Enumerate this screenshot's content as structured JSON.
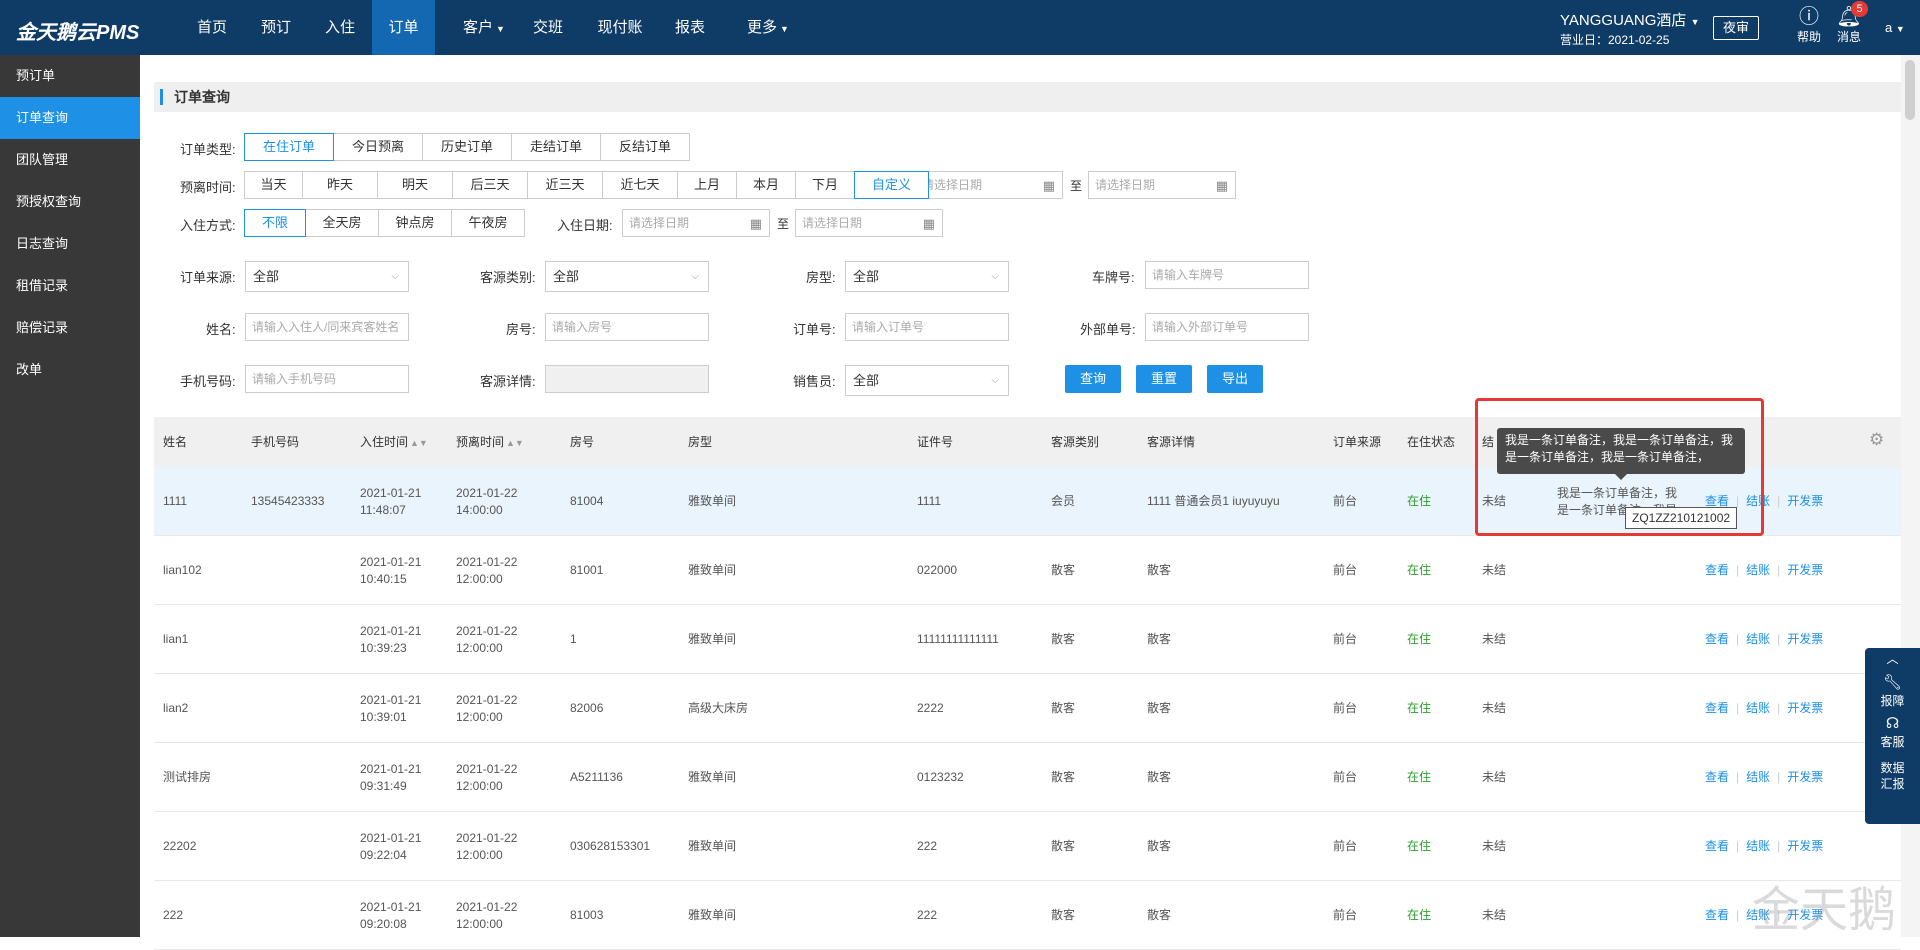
{
  "app": {
    "logo": "金天鹅云PMS"
  },
  "topnav": {
    "items": [
      "首页",
      "预订",
      "入住",
      "订单",
      "客户",
      "交班",
      "现付账",
      "报表",
      "更多"
    ],
    "active": "订单"
  },
  "header": {
    "hotel": "YANGGUANG酒店",
    "business_day": "营业日：2021-02-25",
    "night_audit": "夜审",
    "help": "帮助",
    "messages": "消息",
    "message_count": "5",
    "user": "a"
  },
  "sidebar": {
    "items": [
      "预订单",
      "订单查询",
      "团队管理",
      "预授权查询",
      "日志查询",
      "租借记录",
      "赔偿记录",
      "改单"
    ],
    "active": "订单查询"
  },
  "page": {
    "title": "订单查询"
  },
  "filters": {
    "order_type": {
      "label": "订单类型:",
      "options": [
        "在住订单",
        "今日预离",
        "历史订单",
        "走结订单",
        "反结订单"
      ],
      "selected": "在住订单"
    },
    "departure_time": {
      "label": "预离时间:",
      "options": [
        "当天",
        "昨天",
        "明天",
        "后三天",
        "近三天",
        "近七天",
        "上月",
        "本月",
        "下月",
        "自定义"
      ],
      "selected": "自定义",
      "date_placeholder": "请选择日期",
      "to": "至"
    },
    "checkin_mode": {
      "label": "入住方式:",
      "options": [
        "不限",
        "全天房",
        "钟点房",
        "午夜房"
      ],
      "selected": "不限"
    },
    "checkin_date": {
      "label": "入住日期:",
      "date_placeholder": "请选择日期",
      "to": "至"
    },
    "order_source": {
      "label": "订单来源:",
      "value": "全部"
    },
    "guest_category": {
      "label": "客源类别:",
      "value": "全部"
    },
    "room_type": {
      "label": "房型:",
      "value": "全部"
    },
    "plate": {
      "label": "车牌号:",
      "placeholder": "请输入车牌号"
    },
    "name": {
      "label": "姓名:",
      "placeholder": "请输入入住人/同来宾客姓名"
    },
    "room_no": {
      "label": "房号:",
      "placeholder": "请输入房号"
    },
    "order_no": {
      "label": "订单号:",
      "placeholder": "请输入订单号"
    },
    "external_no": {
      "label": "外部单号:",
      "placeholder": "请输入外部订单号"
    },
    "phone": {
      "label": "手机号码:",
      "placeholder": "请输入手机号码"
    },
    "guest_detail": {
      "label": "客源详情:"
    },
    "salesperson": {
      "label": "销售员:",
      "value": "全部"
    },
    "buttons": {
      "query": "查询",
      "reset": "重置",
      "export": "导出"
    }
  },
  "table": {
    "headers": {
      "name": "姓名",
      "phone": "手机号码",
      "checkin": "入住时间",
      "departure": "预离时间",
      "room": "房号",
      "roomtype": "房型",
      "idno": "证件号",
      "category": "客源类别",
      "detail": "客源详情",
      "source": "订单来源",
      "status": "在住状态",
      "settle": "结"
    },
    "actions": {
      "view": "查看",
      "checkout": "结账",
      "invoice": "开发票"
    },
    "rows": [
      {
        "name": "1111",
        "phone": "13545423333",
        "checkin_date": "2021-01-21",
        "checkin_time": "11:48:07",
        "dep_date": "2021-01-22",
        "dep_time": "14:00:00",
        "room": "81004",
        "roomtype": "雅致单间",
        "idno": "1111",
        "category": "会员",
        "detail": "1111 普通会员1 iuyuyuyu",
        "source": "前台",
        "status": "在住",
        "settle": "未结",
        "remark_line1": "我是一条订单备注，我",
        "remark_line2": "是一条订单备注，我是"
      },
      {
        "name": "lian102",
        "phone": "",
        "checkin_date": "2021-01-21",
        "checkin_time": "10:40:15",
        "dep_date": "2021-01-22",
        "dep_time": "12:00:00",
        "room": "81001",
        "roomtype": "雅致单间",
        "idno": "022000",
        "category": "散客",
        "detail": "散客",
        "source": "前台",
        "status": "在住",
        "settle": "未结",
        "remark_line1": "",
        "remark_line2": ""
      },
      {
        "name": "lian1",
        "phone": "",
        "checkin_date": "2021-01-21",
        "checkin_time": "10:39:23",
        "dep_date": "2021-01-22",
        "dep_time": "12:00:00",
        "room": "1",
        "roomtype": "雅致单间",
        "idno": "11111111111111",
        "category": "散客",
        "detail": "散客",
        "source": "前台",
        "status": "在住",
        "settle": "未结",
        "remark_line1": "",
        "remark_line2": ""
      },
      {
        "name": "lian2",
        "phone": "",
        "checkin_date": "2021-01-21",
        "checkin_time": "10:39:01",
        "dep_date": "2021-01-22",
        "dep_time": "12:00:00",
        "room": "82006",
        "roomtype": "高级大床房",
        "idno": "2222",
        "category": "散客",
        "detail": "散客",
        "source": "前台",
        "status": "在住",
        "settle": "未结",
        "remark_line1": "",
        "remark_line2": ""
      },
      {
        "name": "测试排房",
        "phone": "",
        "checkin_date": "2021-01-21",
        "checkin_time": "09:31:49",
        "dep_date": "2021-01-22",
        "dep_time": "12:00:00",
        "room": "A5211136",
        "roomtype": "雅致单间",
        "idno": "0123232",
        "category": "散客",
        "detail": "散客",
        "source": "前台",
        "status": "在住",
        "settle": "未结",
        "remark_line1": "",
        "remark_line2": ""
      },
      {
        "name": "22202",
        "phone": "",
        "checkin_date": "2021-01-21",
        "checkin_time": "09:22:04",
        "dep_date": "2021-01-22",
        "dep_time": "12:00:00",
        "room": "030628153301",
        "roomtype": "雅致单间",
        "idno": "222",
        "category": "散客",
        "detail": "散客",
        "source": "前台",
        "status": "在住",
        "settle": "未结",
        "remark_line1": "",
        "remark_line2": ""
      },
      {
        "name": "222",
        "phone": "",
        "checkin_date": "2021-01-21",
        "checkin_time": "09:20:08",
        "dep_date": "2021-01-22",
        "dep_time": "12:00:00",
        "room": "81003",
        "roomtype": "雅致单间",
        "idno": "222",
        "category": "散客",
        "detail": "散客",
        "source": "前台",
        "status": "在住",
        "settle": "未结",
        "remark_line1": "",
        "remark_line2": ""
      }
    ]
  },
  "tooltip": {
    "line1": "我是一条订单备注，我是一条订单备注，我",
    "line2": "是一条订单备注，我是一条订单备注，"
  },
  "order_tip": "ZQ1ZZ210121002",
  "rightpanel": {
    "repair": "报障",
    "service": "客服",
    "report": "数据汇报"
  },
  "watermark": "金天鹅",
  "colors": {
    "topbar": "#0f3c66",
    "accent": "#1e90e6",
    "sidebar": "#383838",
    "status_green": "#2ca02c",
    "highlight_red": "#e53935"
  }
}
